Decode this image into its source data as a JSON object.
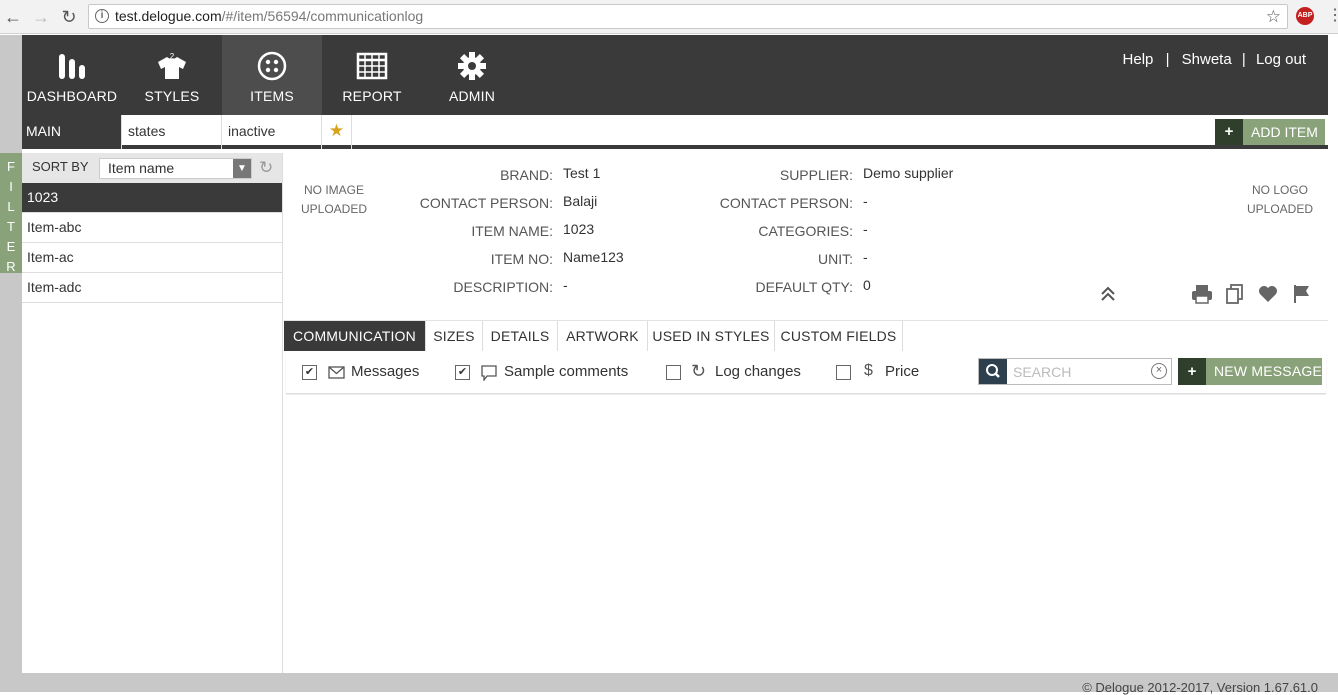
{
  "browser": {
    "url": "test.delogue.com/#/item/56594/communicationlog",
    "url_host": "test.delogue.com",
    "url_path": "/#/item/56594/communicationlog",
    "extension_badge": "ABP"
  },
  "nav": {
    "items": [
      {
        "label": "DASHBOARD",
        "icon": "bar-chart-icon"
      },
      {
        "label": "STYLES",
        "icon": "shirt-icon"
      },
      {
        "label": "ITEMS",
        "icon": "button-icon"
      },
      {
        "label": "REPORT",
        "icon": "table-icon"
      },
      {
        "label": "ADMIN",
        "icon": "gear-icon"
      }
    ],
    "help": "Help",
    "user": "Shweta",
    "logout": "Log out",
    "separator": "|"
  },
  "views": {
    "tabs": [
      "MAIN",
      "states",
      "inactive"
    ],
    "add_item": "ADD ITEM"
  },
  "filter_tab": [
    "F",
    "I",
    "L",
    "T",
    "E",
    "R"
  ],
  "sidebar": {
    "sort_label": "SORT BY",
    "sort_value": "Item name",
    "items": [
      "1023",
      "Item-abc",
      "Item-ac",
      "Item-adc"
    ],
    "selected_index": 0
  },
  "detail": {
    "no_image": [
      "NO IMAGE",
      "UPLOADED"
    ],
    "no_logo": [
      "NO LOGO",
      "UPLOADED"
    ],
    "left_fields": [
      {
        "label": "BRAND:",
        "value": "Test 1"
      },
      {
        "label": "CONTACT PERSON:",
        "value": "Balaji"
      },
      {
        "label": "ITEM NAME:",
        "value": "1023"
      },
      {
        "label": "ITEM NO:",
        "value": "Name123"
      },
      {
        "label": "DESCRIPTION:",
        "value": "-"
      }
    ],
    "right_fields": [
      {
        "label": "SUPPLIER:",
        "value": "Demo supplier"
      },
      {
        "label": "CONTACT PERSON:",
        "value": "-"
      },
      {
        "label": "CATEGORIES:",
        "value": "-"
      },
      {
        "label": "UNIT:",
        "value": "-"
      },
      {
        "label": "DEFAULT QTY:",
        "value": "0"
      }
    ]
  },
  "content_tabs": [
    "COMMUNICATION",
    "SIZES",
    "DETAILS",
    "ARTWORK",
    "USED IN STYLES",
    "CUSTOM FIELDS"
  ],
  "active_content_tab": "COMMUNICATION",
  "filters": [
    {
      "label": "Messages",
      "checked": true,
      "icon": "envelope-icon"
    },
    {
      "label": "Sample comments",
      "checked": true,
      "icon": "comment-icon"
    },
    {
      "label": "Log changes",
      "checked": false,
      "icon": "refresh-icon"
    },
    {
      "label": "Price",
      "checked": false,
      "icon": "dollar-icon"
    }
  ],
  "search": {
    "placeholder": "SEARCH"
  },
  "new_message": "NEW MESSAGE",
  "footer": "© Delogue 2012-2017, Version 1.67.61.0",
  "colors": {
    "dark": "#3a3a3a",
    "accent_green": "#8aa27a",
    "dark_green": "#2f3f2c",
    "search_blue": "#2e3f4d",
    "star": "#d9a21b"
  }
}
